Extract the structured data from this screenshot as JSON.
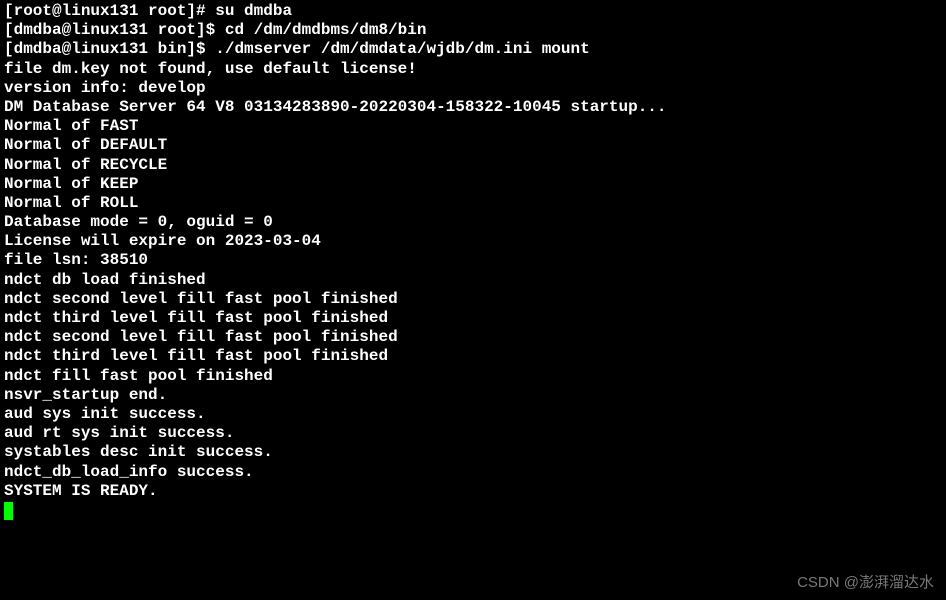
{
  "lines": {
    "l0": "[root@linux131 root]# su dmdba",
    "l1": "[dmdba@linux131 root]$ cd /dm/dmdbms/dm8/bin",
    "l2": "[dmdba@linux131 bin]$ ./dmserver /dm/dmdata/wjdb/dm.ini mount",
    "l3": "file dm.key not found, use default license!",
    "l4": "version info: develop",
    "l5": "DM Database Server 64 V8 03134283890-20220304-158322-10045 startup...",
    "l6": "Normal of FAST",
    "l7": "Normal of DEFAULT",
    "l8": "Normal of RECYCLE",
    "l9": "Normal of KEEP",
    "l10": "Normal of ROLL",
    "l11": "Database mode = 0, oguid = 0",
    "l12": "License will expire on 2023-03-04",
    "l13": "file lsn: 38510",
    "l14": "ndct db load finished",
    "l15": "ndct second level fill fast pool finished",
    "l16": "ndct third level fill fast pool finished",
    "l17": "ndct second level fill fast pool finished",
    "l18": "ndct third level fill fast pool finished",
    "l19": "ndct fill fast pool finished",
    "l20": "nsvr_startup end.",
    "l21": "aud sys init success.",
    "l22": "aud rt sys init success.",
    "l23": "systables desc init success.",
    "l24": "ndct_db_load_info success.",
    "l25": "SYSTEM IS READY."
  },
  "watermark": "CSDN @澎湃溜达水"
}
